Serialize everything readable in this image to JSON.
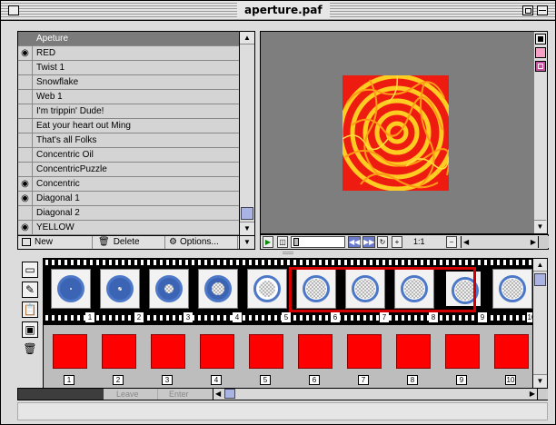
{
  "window": {
    "title": "aperture.paf"
  },
  "list": {
    "header": "Apeture",
    "items": [
      {
        "label": "RED",
        "eye": true
      },
      {
        "label": "Twist 1",
        "eye": false
      },
      {
        "label": "Snowflake",
        "eye": false
      },
      {
        "label": "Web 1",
        "eye": false
      },
      {
        "label": "I'm trippin' Dude!",
        "eye": false
      },
      {
        "label": "Eat your heart out Ming",
        "eye": false
      },
      {
        "label": "That's all Folks",
        "eye": false
      },
      {
        "label": "Concentric Oil",
        "eye": false
      },
      {
        "label": "ConcentricPuzzle",
        "eye": false
      },
      {
        "label": "Concentric",
        "eye": true
      },
      {
        "label": "Diagonal 1",
        "eye": true
      },
      {
        "label": "Diagonal 2",
        "eye": false
      },
      {
        "label": "YELLOW",
        "eye": true
      }
    ],
    "footer": {
      "new_label": "New",
      "delete_label": "Delete",
      "options_label": "Options..."
    }
  },
  "preview": {
    "zoom": "1:1"
  },
  "filmstrip": {
    "frame_numbers": [
      "1",
      "2",
      "3",
      "4",
      "5",
      "6",
      "7",
      "8",
      "9",
      "10"
    ],
    "selected_range": [
      6,
      9
    ],
    "current_frame": 9
  },
  "cels": {
    "numbers": [
      "1",
      "2",
      "3",
      "4",
      "5",
      "6",
      "7",
      "8",
      "9",
      "10"
    ]
  },
  "bottom": {
    "leave_label": "Leave",
    "enter_label": "Enter"
  },
  "colors": {
    "selection": "#d40000",
    "cel": "#ff0000",
    "aperture_blue": "#4d78c8",
    "preview_bg": "#7e7e7e"
  }
}
